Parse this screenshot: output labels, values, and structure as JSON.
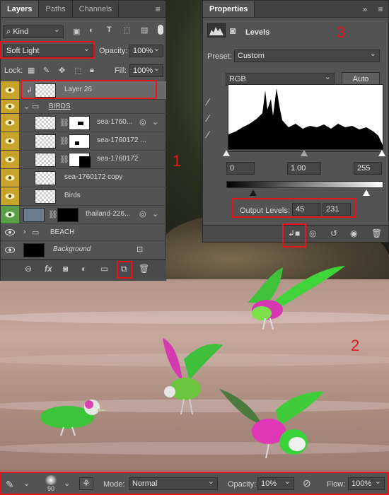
{
  "layers_panel": {
    "tabs": [
      "Layers",
      "Paths",
      "Channels"
    ],
    "filter_kind": "Kind",
    "blend_mode": "Soft Light",
    "opacity_label": "Opacity:",
    "opacity_value": "100%",
    "lock_label": "Lock:",
    "fill_label": "Fill:",
    "fill_value": "100%",
    "layers": [
      {
        "name": "Layer 26",
        "eye": "gold"
      },
      {
        "name": "BIRDS",
        "eye": "gold"
      },
      {
        "name": "sea-1760...",
        "eye": "gold"
      },
      {
        "name": "sea-1760172 ...",
        "eye": "gold"
      },
      {
        "name": "sea-1760172",
        "eye": "gold"
      },
      {
        "name": "sea-1760172 copy",
        "eye": "gold"
      },
      {
        "name": "Birds",
        "eye": "gold"
      },
      {
        "name": "thailand-226...",
        "eye": "green"
      },
      {
        "name": "BEACH",
        "eye": "none"
      },
      {
        "name": "Background",
        "eye": "none"
      }
    ]
  },
  "properties_panel": {
    "title": "Properties",
    "adjustment_name": "Levels",
    "preset_label": "Preset:",
    "preset_value": "Custom",
    "channel": "RGB",
    "auto_label": "Auto",
    "input_black": "0",
    "input_gamma": "1.00",
    "input_white": "255",
    "output_label": "Output Levels:",
    "output_black": "45",
    "output_white": "231"
  },
  "annotations": {
    "n1": "1",
    "n2": "2",
    "n3": "3"
  },
  "toolbar": {
    "brush_size": "90",
    "mode_label": "Mode:",
    "mode_value": "Normal",
    "opacity_label": "Opacity:",
    "opacity_value": "10%",
    "flow_label": "Flow:",
    "flow_value": "100%"
  },
  "colors": {
    "highlight": "#e8141c",
    "eye_gold": "#c7a32b",
    "eye_green": "#5a9f48",
    "panel": "#535353"
  },
  "icons": [
    "eye-icon",
    "folder-icon",
    "link-icon",
    "mask-icon",
    "fx-icon",
    "new-layer-icon",
    "trash-icon",
    "clip-icon",
    "eyedropper-icon",
    "brush-icon",
    "airbrush-icon",
    "pressure-icon"
  ]
}
